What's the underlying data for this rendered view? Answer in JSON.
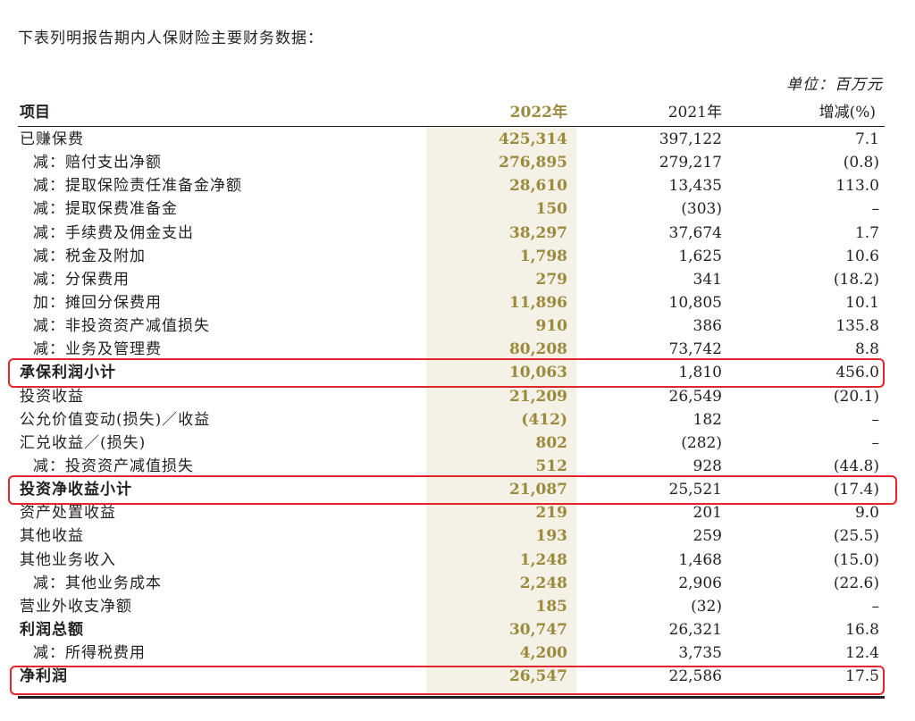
{
  "intro": "下表列明报告期内人保财险主要财务数据：",
  "unit": "单位：百万元",
  "header": {
    "item": "项目",
    "y2022": "2022年",
    "y2021": "2021年",
    "change": "增减(%)"
  },
  "rows": [
    {
      "label": "已赚保费",
      "v2022": "425,314",
      "v2021": "397,122",
      "change": "7.1",
      "indent": false,
      "bold": false
    },
    {
      "label": "减：赔付支出净额",
      "v2022": "276,895",
      "v2021": "279,217",
      "change": "(0.8)",
      "indent": true,
      "bold": false
    },
    {
      "label": "减：提取保险责任准备金净额",
      "v2022": "28,610",
      "v2021": "13,435",
      "change": "113.0",
      "indent": true,
      "bold": false
    },
    {
      "label": "减：提取保费准备金",
      "v2022": "150",
      "v2021": "(303)",
      "change": "–",
      "indent": true,
      "bold": false
    },
    {
      "label": "减：手续费及佣金支出",
      "v2022": "38,297",
      "v2021": "37,674",
      "change": "1.7",
      "indent": true,
      "bold": false
    },
    {
      "label": "减：税金及附加",
      "v2022": "1,798",
      "v2021": "1,625",
      "change": "10.6",
      "indent": true,
      "bold": false
    },
    {
      "label": "减：分保费用",
      "v2022": "279",
      "v2021": "341",
      "change": "(18.2)",
      "indent": true,
      "bold": false
    },
    {
      "label": "加：摊回分保费用",
      "v2022": "11,896",
      "v2021": "10,805",
      "change": "10.1",
      "indent": true,
      "bold": false
    },
    {
      "label": "减：非投资资产减值损失",
      "v2022": "910",
      "v2021": "386",
      "change": "135.8",
      "indent": true,
      "bold": false
    },
    {
      "label": "减：业务及管理费",
      "v2022": "80,208",
      "v2021": "73,742",
      "change": "8.8",
      "indent": true,
      "bold": false
    },
    {
      "label": "承保利润小计",
      "v2022": "10,063",
      "v2021": "1,810",
      "change": "456.0",
      "indent": false,
      "bold": true
    },
    {
      "label": "投资收益",
      "v2022": "21,209",
      "v2021": "26,549",
      "change": "(20.1)",
      "indent": false,
      "bold": false
    },
    {
      "label": "公允价值变动(损失)／收益",
      "v2022": "(412)",
      "v2021": "182",
      "change": "–",
      "indent": false,
      "bold": false
    },
    {
      "label": "汇兑收益／(损失)",
      "v2022": "802",
      "v2021": "(282)",
      "change": "–",
      "indent": false,
      "bold": false
    },
    {
      "label": "减：投资资产减值损失",
      "v2022": "512",
      "v2021": "928",
      "change": "(44.8)",
      "indent": true,
      "bold": false
    },
    {
      "label": "投资净收益小计",
      "v2022": "21,087",
      "v2021": "25,521",
      "change": "(17.4)",
      "indent": false,
      "bold": true
    },
    {
      "label": "资产处置收益",
      "v2022": "219",
      "v2021": "201",
      "change": "9.0",
      "indent": false,
      "bold": false
    },
    {
      "label": "其他收益",
      "v2022": "193",
      "v2021": "259",
      "change": "(25.5)",
      "indent": false,
      "bold": false
    },
    {
      "label": "其他业务收入",
      "v2022": "1,248",
      "v2021": "1,468",
      "change": "(15.0)",
      "indent": false,
      "bold": false
    },
    {
      "label": "减：其他业务成本",
      "v2022": "2,248",
      "v2021": "2,906",
      "change": "(22.6)",
      "indent": true,
      "bold": false
    },
    {
      "label": "营业外收支净额",
      "v2022": "185",
      "v2021": "(32)",
      "change": "–",
      "indent": false,
      "bold": false
    },
    {
      "label": "利润总额",
      "v2022": "30,747",
      "v2021": "26,321",
      "change": "16.8",
      "indent": false,
      "bold": true
    },
    {
      "label": "减：所得税费用",
      "v2022": "4,200",
      "v2021": "3,735",
      "change": "12.4",
      "indent": true,
      "bold": false
    },
    {
      "label": "净利润",
      "v2022": "26,547",
      "v2021": "22,586",
      "change": "17.5",
      "indent": false,
      "bold": true
    }
  ],
  "highlight_color": "#e3262b",
  "accent_color": "#9c8a3c"
}
